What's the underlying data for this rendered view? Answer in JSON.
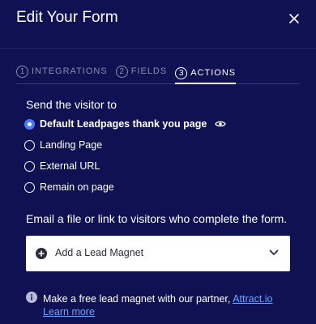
{
  "header": {
    "title": "Edit Your Form",
    "close_icon": "close-icon"
  },
  "tabs": [
    {
      "num": "1",
      "label": "INTEGRATIONS",
      "active": false
    },
    {
      "num": "2",
      "label": "FIELDS",
      "active": false
    },
    {
      "num": "3",
      "label": "ACTIONS",
      "active": true
    }
  ],
  "send_section": {
    "label": "Send the visitor to",
    "options": [
      {
        "label": "Default Leadpages thank you page",
        "selected": true
      },
      {
        "label": "Landing Page",
        "selected": false
      },
      {
        "label": "External URL",
        "selected": false
      },
      {
        "label": "Remain on page",
        "selected": false
      }
    ]
  },
  "email_section": {
    "label": "Email a file or link to visitors who complete the form.",
    "dropdown_value": "Add a Lead Magnet"
  },
  "info": {
    "text": "Make a free lead magnet with our partner,",
    "partner_link": "Attract.io",
    "learn_more_link": "Learn more"
  },
  "colors": {
    "background": "#101152",
    "accent": "#4a7bff",
    "link": "#6fa3ff"
  }
}
